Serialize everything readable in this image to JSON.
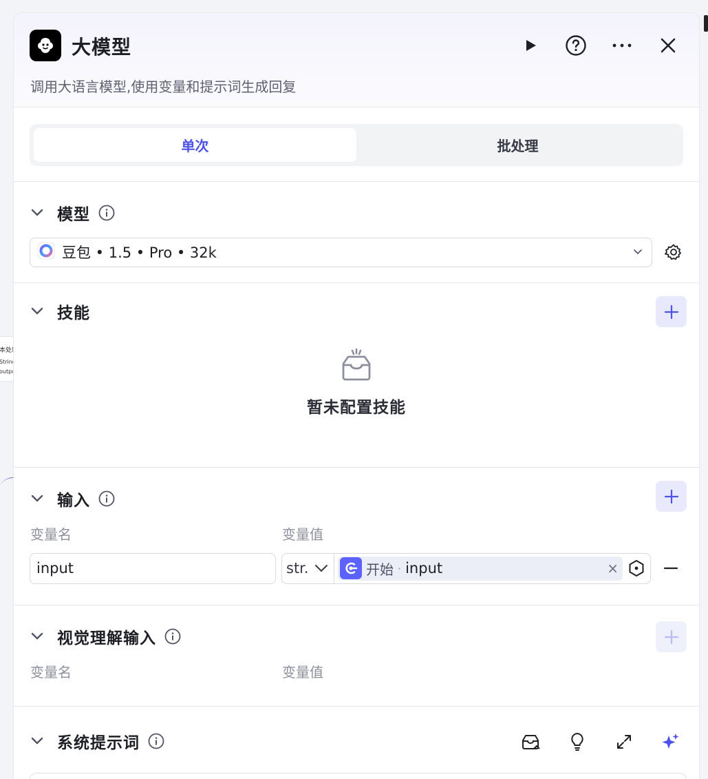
{
  "canvas": {
    "node_title": "本处理",
    "node_type": "String",
    "node_output": "output"
  },
  "header": {
    "title": "大模型",
    "subtitle": "调用大语言模型,使用变量和提示词生成回复"
  },
  "mode_tabs": [
    {
      "label": "单次",
      "active": true
    },
    {
      "label": "批处理",
      "active": false
    }
  ],
  "model_section": {
    "title": "模型",
    "selected_model": "豆包 • 1.5 • Pro • 32k"
  },
  "skills_section": {
    "title": "技能",
    "empty_text": "暂未配置技能"
  },
  "input_section": {
    "title": "输入",
    "col_name": "变量名",
    "col_value": "变量值",
    "rows": [
      {
        "name": "input",
        "type": "str.",
        "source": "开始",
        "separator": "·",
        "ref_var": "input"
      }
    ]
  },
  "vision_section": {
    "title": "视觉理解输入",
    "col_name": "变量名",
    "col_value": "变量值"
  },
  "system_prompt_section": {
    "title": "系统提示词"
  },
  "colors": {
    "accent": "#4d53e8",
    "accent_soft": "#e8e9fc",
    "ref_icon": "#5c62ff"
  }
}
